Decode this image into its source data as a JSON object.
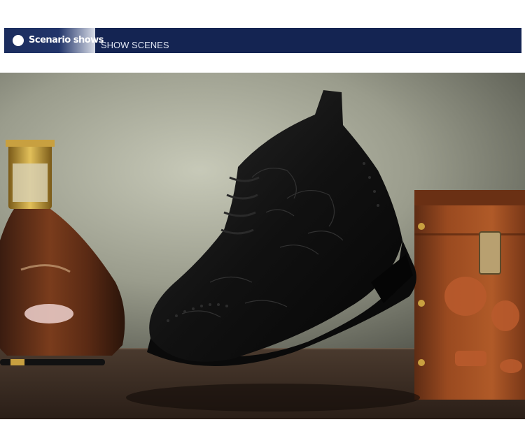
{
  "section_header": {
    "title": "Scenario shows",
    "subtitle": "SHOW SCENES"
  },
  "colors": {
    "banner_bg": "#142452",
    "page_bg": "#ffffff"
  },
  "scene": {
    "icons": [
      "bottle-icon",
      "boot-icon",
      "wooden-box-icon",
      "pen-icon"
    ]
  }
}
